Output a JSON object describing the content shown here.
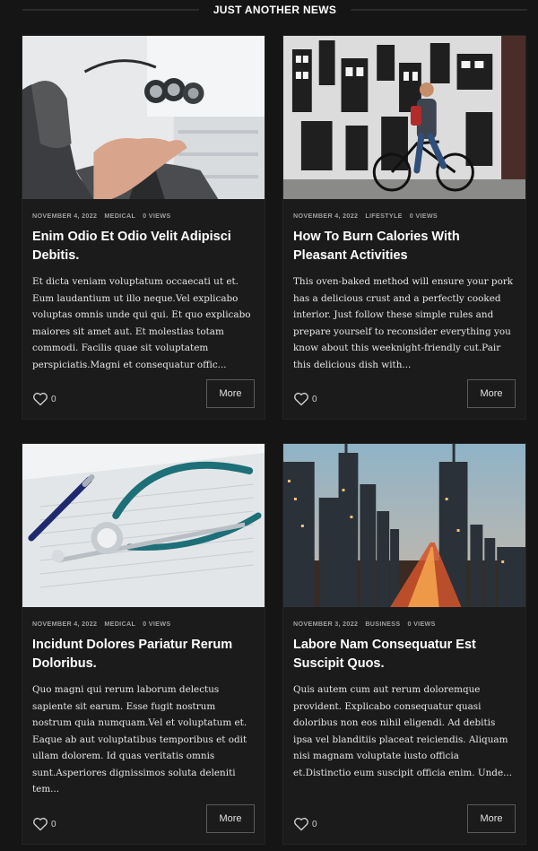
{
  "section": {
    "title": "JUST ANOTHER NEWS"
  },
  "posts": [
    {
      "date": "NOVEMBER 4, 2022",
      "category": "MEDICAL",
      "views": "0 VIEWS",
      "title": "Enim Odio Et Odio Velit Adipisci Debitis.",
      "excerpt": "Et dicta veniam voluptatum occaecati ut et. Eum laudantium ut illo neque.Vel explicabo voluptas omnis unde qui qui. Et quo explicabo maiores sit amet aut. Et molestias totam commodi. Facilis quae sit voluptatem perspiciatis.Magni et consequatur offic...",
      "likes": "0",
      "more_label": "More"
    },
    {
      "date": "NOVEMBER 4, 2022",
      "category": "LIFESTYLE",
      "views": "0 VIEWS",
      "title": "How To Burn Calories With Pleasant Activities",
      "excerpt": "This oven-baked method will ensure your pork has a delicious crust and a perfectly cooked interior. Just follow these simple rules and prepare yourself to reconsider everything you know about this weeknight-friendly cut.Pair this delicious dish with...",
      "likes": "0",
      "more_label": "More"
    },
    {
      "date": "NOVEMBER 4, 2022",
      "category": "MEDICAL",
      "views": "0 VIEWS",
      "title": "Incidunt Dolores Pariatur Rerum Doloribus.",
      "excerpt": "Quo magni qui rerum laborum delectus sapiente sit earum. Esse fugit nostrum nostrum quia numquam.Vel et voluptatum et. Eaque ab aut voluptatibus temporibus et odit ullam dolorem. Id quas veritatis omnis sunt.Asperiores dignissimos soluta deleniti tem...",
      "likes": "0",
      "more_label": "More"
    },
    {
      "date": "NOVEMBER 3, 2022",
      "category": "BUSINESS",
      "views": "0 VIEWS",
      "title": "Labore Nam Consequatur Est Suscipit Quos.",
      "excerpt": "Quis autem cum aut rerum doloremque provident. Explicabo consequatur quasi doloribus non eos nihil eligendi. Ad debitis ipsa vel blanditiis placeat reiciendis. Aliquam nisi magnam voluptate iusto officia et.Distinctio eum suscipit officia enim. Unde...",
      "likes": "0",
      "more_label": "More"
    }
  ]
}
